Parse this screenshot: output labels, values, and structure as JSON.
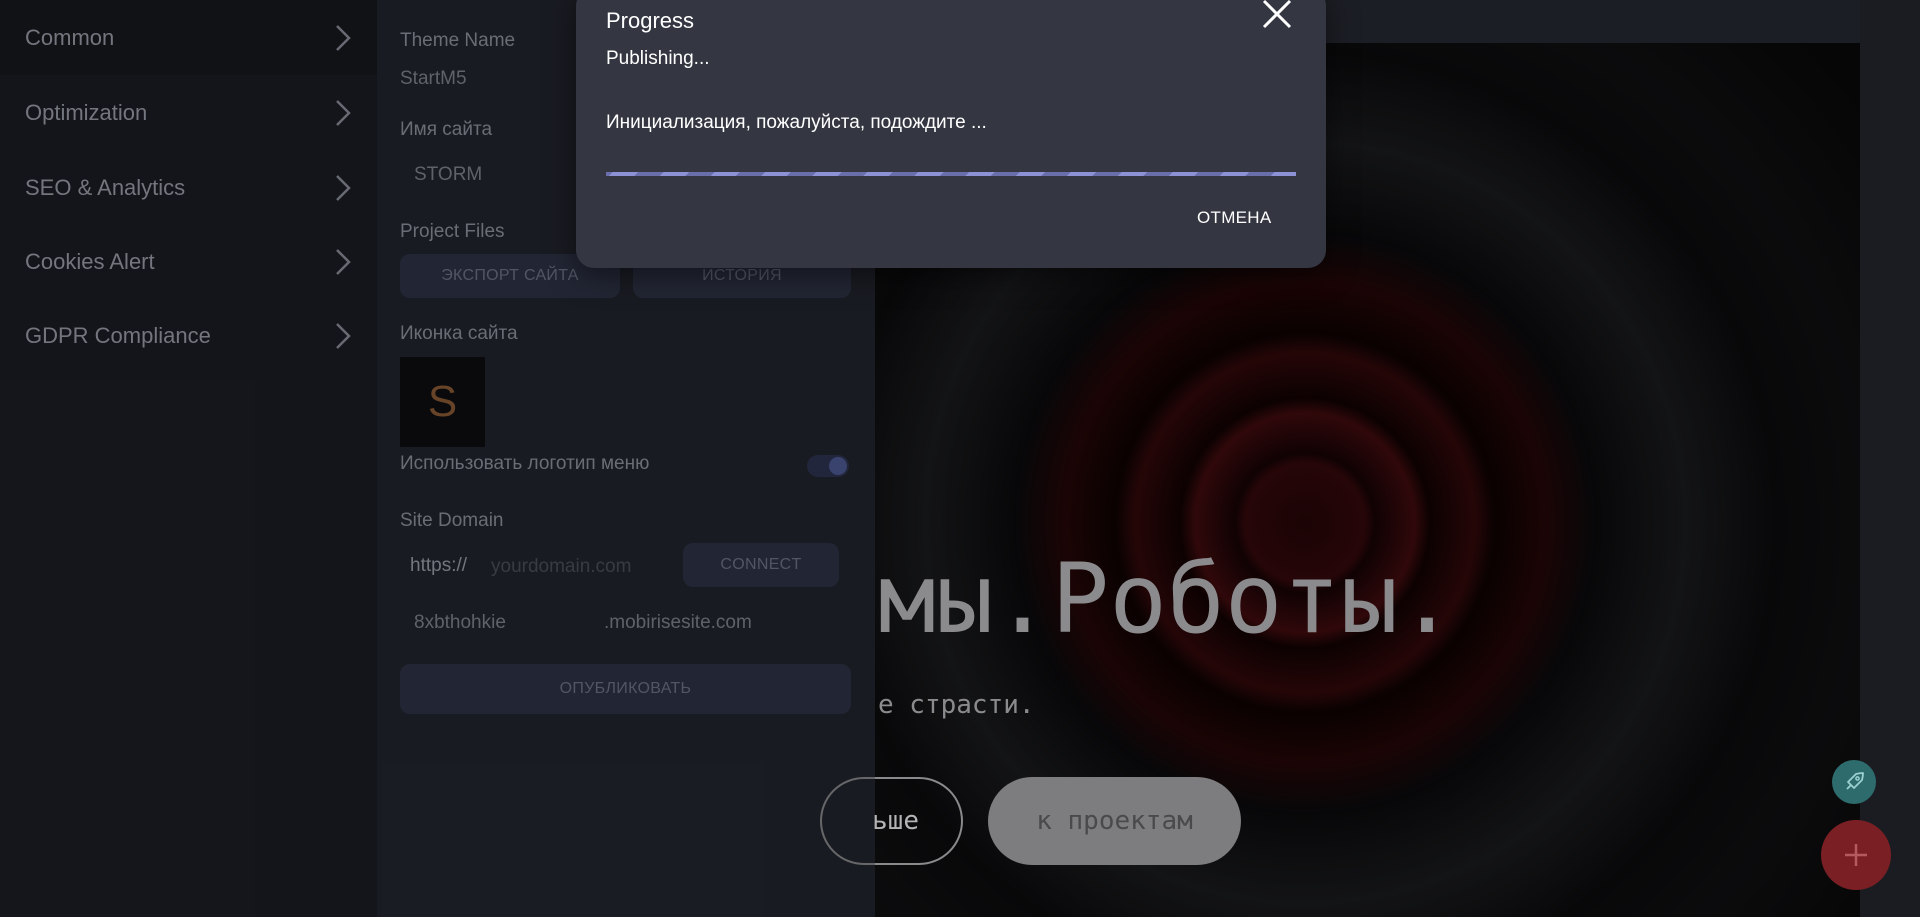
{
  "sidebar": {
    "items": [
      {
        "label": "Common"
      },
      {
        "label": "Optimization"
      },
      {
        "label": "SEO & Analytics"
      },
      {
        "label": "Cookies Alert"
      },
      {
        "label": "GDPR Compliance"
      }
    ]
  },
  "panel": {
    "theme_name_label": "Theme Name",
    "theme_name_value": "StartM5",
    "site_name_label": "Имя сайта",
    "site_name_value": "STORM",
    "project_files_label": "Project Files",
    "export_button": "ЭКСПОРТ САЙТА",
    "history_button": "ИСТОРИЯ",
    "site_icon_label": "Иконка сайта",
    "site_icon_letter": "S",
    "use_menu_logo_label": "Использовать логотип меню",
    "use_menu_logo_on": true,
    "site_domain_label": "Site Domain",
    "protocol": "https://",
    "domain_placeholder": "yourdomain.com",
    "connect_button": "CONNECT",
    "subdomain": "8xbthohkie",
    "subdomain_suffix": ".mobirisesite.com",
    "publish_button": "ОПУБЛИКОВАТЬ"
  },
  "preview": {
    "hero_title": "мы.Роботы.",
    "hero_subtitle": "е страсти.",
    "button_more": "ьше",
    "button_projects": "к проектам"
  },
  "dialog": {
    "title": "Progress",
    "status": "Publishing...",
    "message": "Инициализация, пожалуйста, подождите ...",
    "cancel": "ОТМЕНА"
  },
  "colors": {
    "dialog_bg": "#343742",
    "progress_accent": "#8d91d6",
    "fab_add": "#7a1f24",
    "fab_rocket": "#2e6b6d"
  }
}
